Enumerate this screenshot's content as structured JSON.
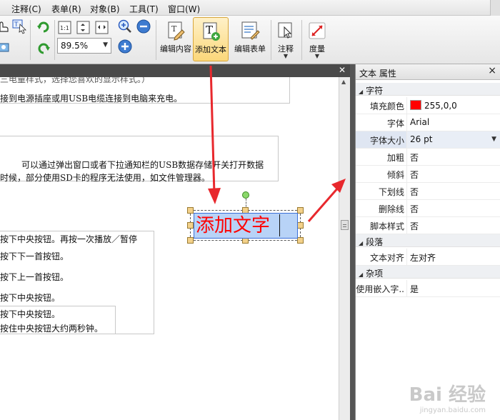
{
  "menu": [
    "注释(C)",
    "表单(R)",
    "对象(B)",
    "工具(T)",
    "窗口(W)"
  ],
  "toolbar": {
    "zoom": "89.5%",
    "buttons": {
      "edit_content": "编辑内容",
      "add_text": "添加文本",
      "edit_form": "编辑表单",
      "annotate": "注释",
      "measure": "度量"
    }
  },
  "document": {
    "lines": [
      "接到电源插座或用USB电缆连接到电脑来充电。",
      "可以通过弹出窗口或者下拉通知栏的USB数据存储开关打开数据",
      "时候，部分使用SD卡的程序无法使用，如文件管理器。",
      "按下中央按钮。再按一次播放／暂停",
      "按下下一首按钮。",
      "按下上一首按钮。",
      "按下中央按钮。",
      "按下中央按钮。",
      "按住中央按钮大约两秒钟。"
    ],
    "annotation_text": "添加文字"
  },
  "properties": {
    "title": "文本 属性",
    "sections": {
      "font": "字符",
      "paragraph": "段落",
      "misc": "杂项"
    },
    "rows": {
      "fill_color": {
        "key": "填充颜色",
        "value": "255,0,0",
        "color": "#ff0000"
      },
      "font": {
        "key": "字体",
        "value": "Arial"
      },
      "font_size": {
        "key": "字体大小",
        "value": "26 pt"
      },
      "bold": {
        "key": "加粗",
        "value": "否"
      },
      "italic": {
        "key": "倾斜",
        "value": "否"
      },
      "underline": {
        "key": "下划线",
        "value": "否"
      },
      "strikethrough": {
        "key": "删除线",
        "value": "否"
      },
      "script": {
        "key": "脚本样式",
        "value": "否"
      },
      "align": {
        "key": "文本对齐",
        "value": "左对齐"
      },
      "embedded": {
        "key": "使用嵌入字..",
        "value": "是"
      }
    }
  },
  "watermark": {
    "brand": "Bai 经验",
    "url": "jingyan.baidu.com"
  }
}
